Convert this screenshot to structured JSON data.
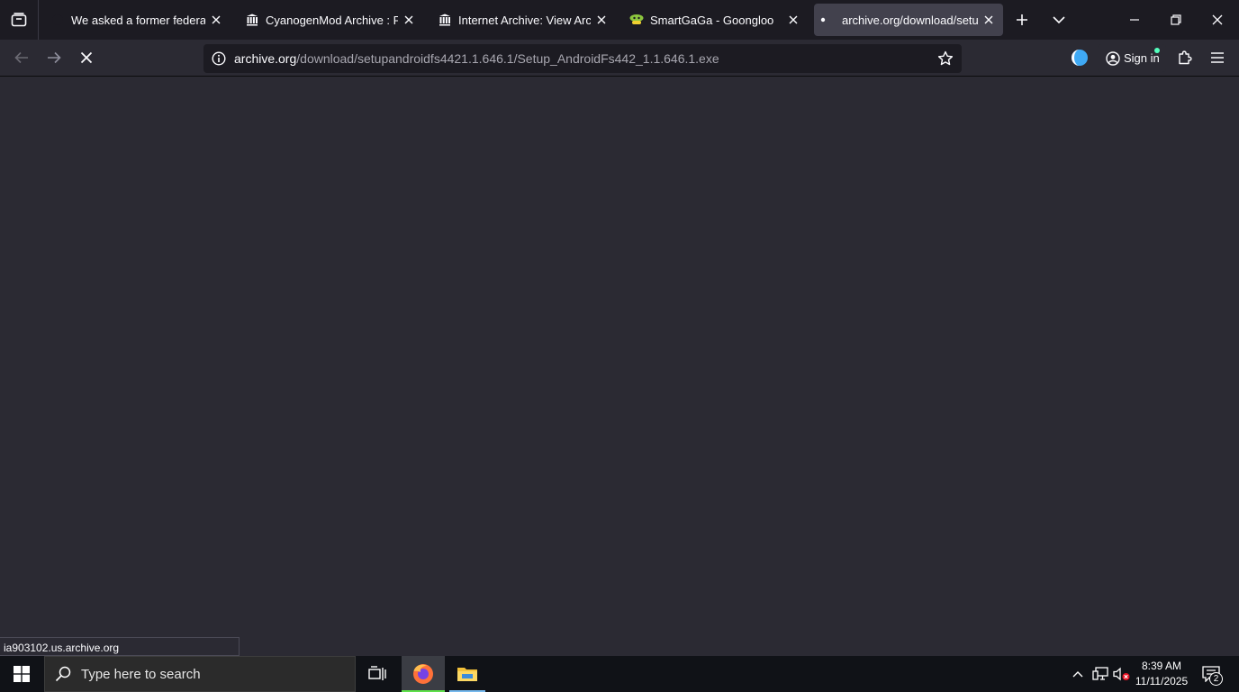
{
  "browser": {
    "tabs": [
      {
        "title": "We asked a former federal ag",
        "active": false
      },
      {
        "title": "CyanogenMod Archive : Free",
        "active": false
      },
      {
        "title": "Internet Archive: View Archive",
        "active": false
      },
      {
        "title": "SmartGaGa - Goongloo",
        "active": false
      },
      {
        "title": "archive.org/download/setupa",
        "active": true
      }
    ],
    "url_domain": "archive.org",
    "url_path": "/download/setupandroidfs4421.1.646.1/Setup_AndroidFs442_1.1.646.1.exe",
    "sign_in_label": "Sign in",
    "status_text": "ia903102.us.archive.org"
  },
  "taskbar": {
    "search_placeholder": "Type here to search",
    "time": "8:39 AM",
    "date": "11/11/2025",
    "notification_count": "2"
  },
  "colors": {
    "accent_firefox": "#ff7139",
    "running_indicator": "#76b9ed",
    "active_indicator": "#5ee04a",
    "folder_yellow": "#f3c13a",
    "smartgaga_green": "#8cc63e",
    "signin_dot": "#54ffbd"
  }
}
